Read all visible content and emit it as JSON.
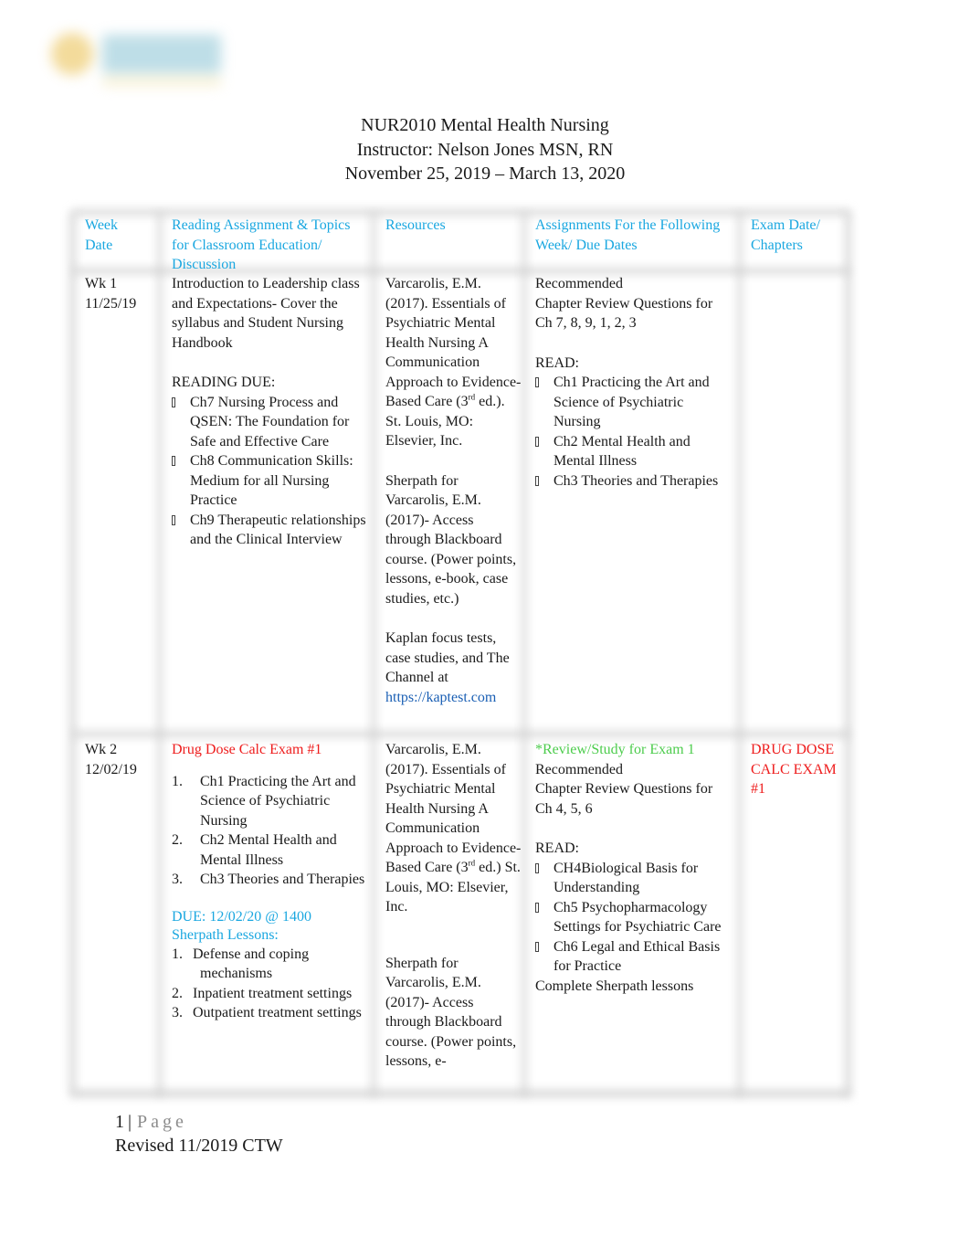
{
  "logo": {
    "name": "institution-logo"
  },
  "header": {
    "course": "NUR2010 Mental Health Nursing",
    "instructor": "Instructor: Nelson Jones MSN, RN",
    "dates": "November 25, 2019 – March 13, 2020"
  },
  "colors": {
    "header_text": "#1aa7e0",
    "exam_red": "#ee1c1c",
    "review_green": "#4ccc4c",
    "link": "#1a5fb4"
  },
  "table": {
    "columns": [
      {
        "line1": "Week",
        "line2": "Date"
      },
      {
        "text": "Reading Assignment & Topics for Classroom Education/ Discussion"
      },
      {
        "text": "Resources"
      },
      {
        "text": "Assignments For the Following Week/ Due Dates"
      },
      {
        "line1": "Exam Date/",
        "line2": "Chapters"
      }
    ],
    "rows": [
      {
        "week": "Wk 1",
        "date": "11/25/19",
        "reading": {
          "intro": "Introduction to Leadership class and Expectations- Cover the syllabus and Student Nursing Handbook",
          "reading_due_label": "READING DUE:",
          "items": [
            "Ch7 Nursing Process and QSEN: The Foundation for Safe and Effective Care",
            "Ch8 Communication Skills: Medium for all Nursing Practice",
            "Ch9 Therapeutic relationships and the Clinical Interview"
          ]
        },
        "resources": {
          "textbook_pre": "Varcarolis, E.M. (2017). Essentials of Psychiatric Mental Health Nursing A Communication Approach to Evidence-Based Care (3",
          "textbook_sup": "rd",
          "textbook_post": " ed.). St. Louis, MO: Elsevier, Inc.",
          "sherpath": "Sherpath for Varcarolis, E.M. (2017)- Access through Blackboard course. (Power points, lessons, e-book, case studies, etc.)",
          "kaplan": "Kaplan focus tests, case studies, and The Channel at",
          "kaplan_link": "https://kaptest.com"
        },
        "assignments": {
          "recommended": "Recommended",
          "review_questions": "Chapter Review Questions for Ch 7, 8, 9, 1, 2, 3",
          "read_label": "READ:",
          "items": [
            "Ch1 Practicing the Art and Science of Psychiatric Nursing",
            "Ch2 Mental Health and Mental Illness",
            "Ch3 Theories and Therapies"
          ]
        },
        "exam": ""
      },
      {
        "week": "Wk 2",
        "date": "12/02/19",
        "reading": {
          "exam_title": "Drug Dose Calc Exam #1",
          "items": [
            {
              "n": "1.",
              "text": "Ch1 Practicing the Art and Science of Psychiatric Nursing"
            },
            {
              "n": "2.",
              "text": "Ch2 Mental Health and Mental Illness"
            },
            {
              "n": "3.",
              "text": "Ch3 Theories and Therapies"
            }
          ],
          "due": "DUE: 12/02/20 @ 1400",
          "sherpath_label": "Sherpath Lessons:",
          "lessons": [
            {
              "n": "1.",
              "text": "Defense and coping mechanisms"
            },
            {
              "n": "2.",
              "text": "Inpatient treatment settings"
            },
            {
              "n": "3.",
              "text": "Outpatient treatment settings"
            }
          ]
        },
        "resources": {
          "textbook_pre": "Varcarolis, E.M. (2017). Essentials of Psychiatric Mental Health Nursing A Communication Approach to Evidence-Based Care (3",
          "textbook_sup": "rd",
          "textbook_post": " ed.) St. Louis, MO: Elsevier, Inc.",
          "sherpath": "Sherpath for Varcarolis, E.M. (2017)- Access through Blackboard course. (Power points, lessons, e-"
        },
        "assignments": {
          "review_note": "*Review/Study for Exam 1",
          "recommended": "Recommended",
          "review_questions": "Chapter Review Questions for Ch 4, 5, 6",
          "read_label": "READ:",
          "items": [
            "CH4Biological Basis for Understanding",
            "Ch5 Psychopharmacology Settings for Psychiatric Care",
            "Ch6 Legal and Ethical Basis for Practice"
          ],
          "complete": "Complete Sherpath lessons"
        },
        "exam": "DRUG DOSE CALC EXAM #1"
      }
    ]
  },
  "footer": {
    "page_number": "1",
    "separator": "|",
    "page_word": "Page",
    "revised": "Revised 11/2019 CTW"
  }
}
